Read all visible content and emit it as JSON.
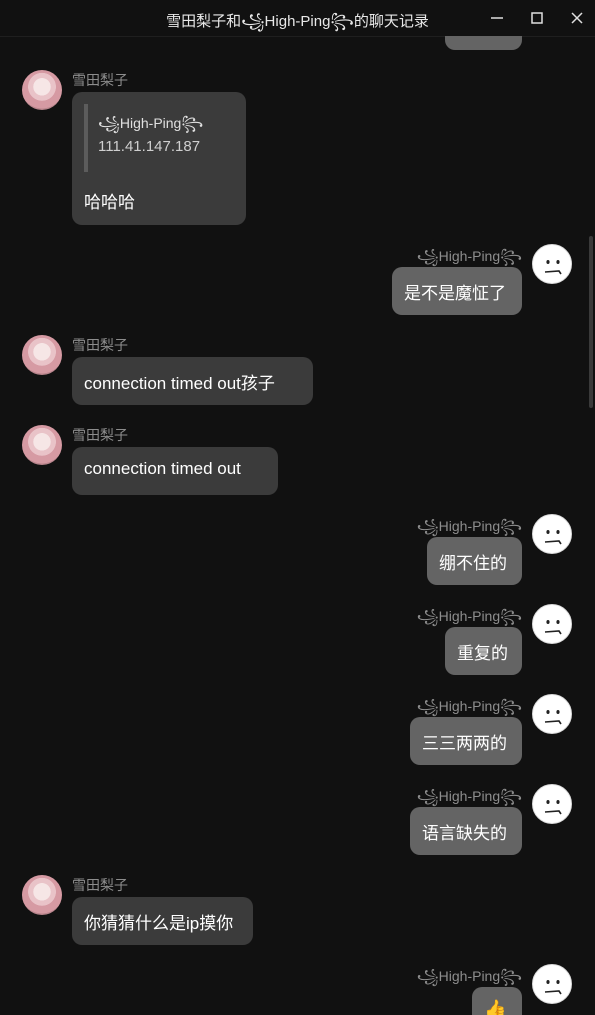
{
  "window": {
    "title": "雪田梨子和꧁High-Ping꧂的聊天记录"
  },
  "contacts": {
    "other_name": "雪田梨子",
    "self_name": "꧁High-Ping꧂"
  },
  "messages": [
    {
      "from": "雪田梨子",
      "quote_name": "꧁High-Ping꧂",
      "quote_text": "111.41.147.187",
      "text": "哈哈哈"
    },
    {
      "from": "꧁High-Ping꧂",
      "text": "是不是魔怔了"
    },
    {
      "from": "雪田梨子",
      "text": "connection timed out孩子"
    },
    {
      "from": "雪田梨子",
      "text": "connection timed out"
    },
    {
      "from": "꧁High-Ping꧂",
      "text": "绷不住的"
    },
    {
      "from": "꧁High-Ping꧂",
      "text": "重复的"
    },
    {
      "from": "꧁High-Ping꧂",
      "text": "三三两两的"
    },
    {
      "from": "꧁High-Ping꧂",
      "text": "语言缺失的"
    },
    {
      "from": "雪田梨子",
      "text": "你猜猜什么是ip摸你"
    },
    {
      "from": "꧁High-Ping꧂",
      "text": "👍"
    }
  ],
  "icons": {
    "minimize": "minimize-icon",
    "maximize": "maximize-icon",
    "close": "close-icon"
  }
}
